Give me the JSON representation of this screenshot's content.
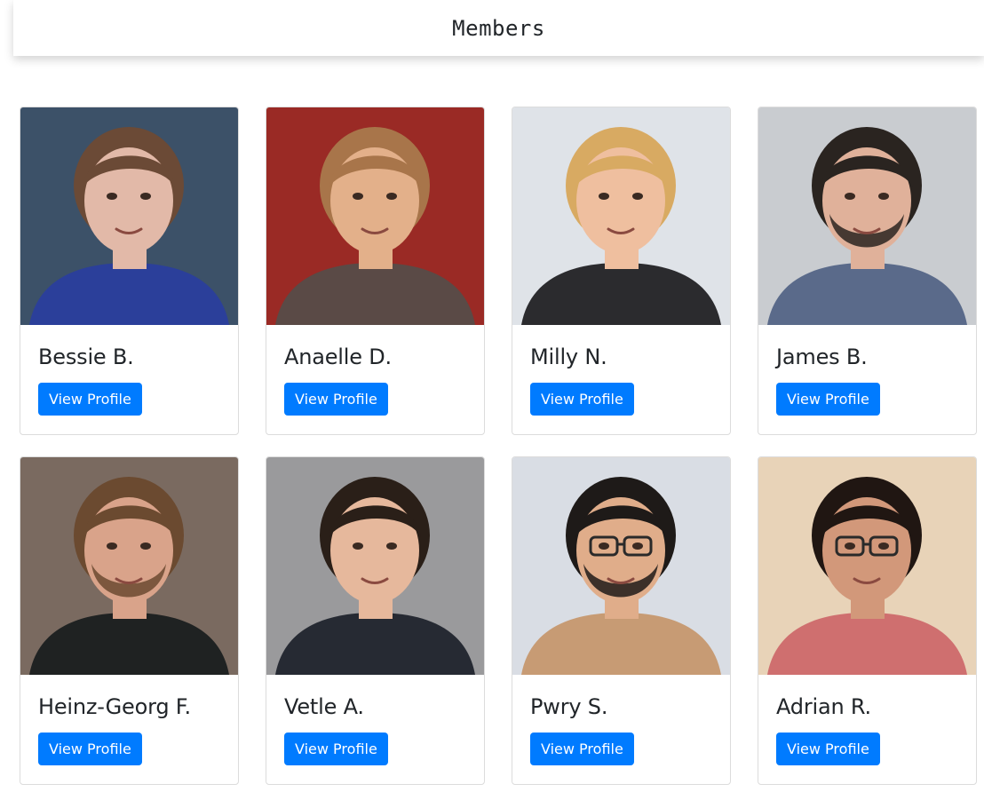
{
  "header": {
    "title": "Members"
  },
  "accent_color": "#007bff",
  "members": [
    {
      "name": "Bessie B.",
      "button_label": "View Profile",
      "photo": {
        "bg": "#3c5168",
        "skin": "#e2b9a8",
        "hair": "#6b4a36",
        "shirt": "#2b3f9a",
        "glasses": false,
        "beard": false
      }
    },
    {
      "name": "Anaelle D.",
      "button_label": "View Profile",
      "photo": {
        "bg": "#9a2a25",
        "skin": "#e3b08a",
        "hair": "#a8754a",
        "shirt": "#5a4a46",
        "glasses": false,
        "beard": false
      }
    },
    {
      "name": "Milly N.",
      "button_label": "View Profile",
      "photo": {
        "bg": "#dfe3e8",
        "skin": "#efbf9f",
        "hair": "#d8aa62",
        "shirt": "#2b2b2e",
        "glasses": false,
        "beard": false
      }
    },
    {
      "name": "James B.",
      "button_label": "View Profile",
      "photo": {
        "bg": "#c9ccd0",
        "skin": "#e0b19a",
        "hair": "#2a2420",
        "shirt": "#5a6a8a",
        "glasses": false,
        "beard": true
      }
    },
    {
      "name": "Heinz-Georg F.",
      "button_label": "View Profile",
      "photo": {
        "bg": "#7a6a60",
        "skin": "#d9a38a",
        "hair": "#6b4a30",
        "shirt": "#1f2222",
        "glasses": false,
        "beard": true
      }
    },
    {
      "name": "Vetle A.",
      "button_label": "View Profile",
      "photo": {
        "bg": "#9a9a9c",
        "skin": "#e6b89c",
        "hair": "#2a1f18",
        "shirt": "#262a33",
        "glasses": false,
        "beard": false
      }
    },
    {
      "name": "Pwry S.",
      "button_label": "View Profile",
      "photo": {
        "bg": "#d9dde4",
        "skin": "#e0ad8a",
        "hair": "#1e1a18",
        "shirt": "#c79b74",
        "glasses": true,
        "beard": true
      }
    },
    {
      "name": "Adrian R.",
      "button_label": "View Profile",
      "photo": {
        "bg": "#e8d3b8",
        "skin": "#d2987a",
        "hair": "#201612",
        "shirt": "#cf6f6f",
        "glasses": true,
        "beard": false
      }
    }
  ]
}
